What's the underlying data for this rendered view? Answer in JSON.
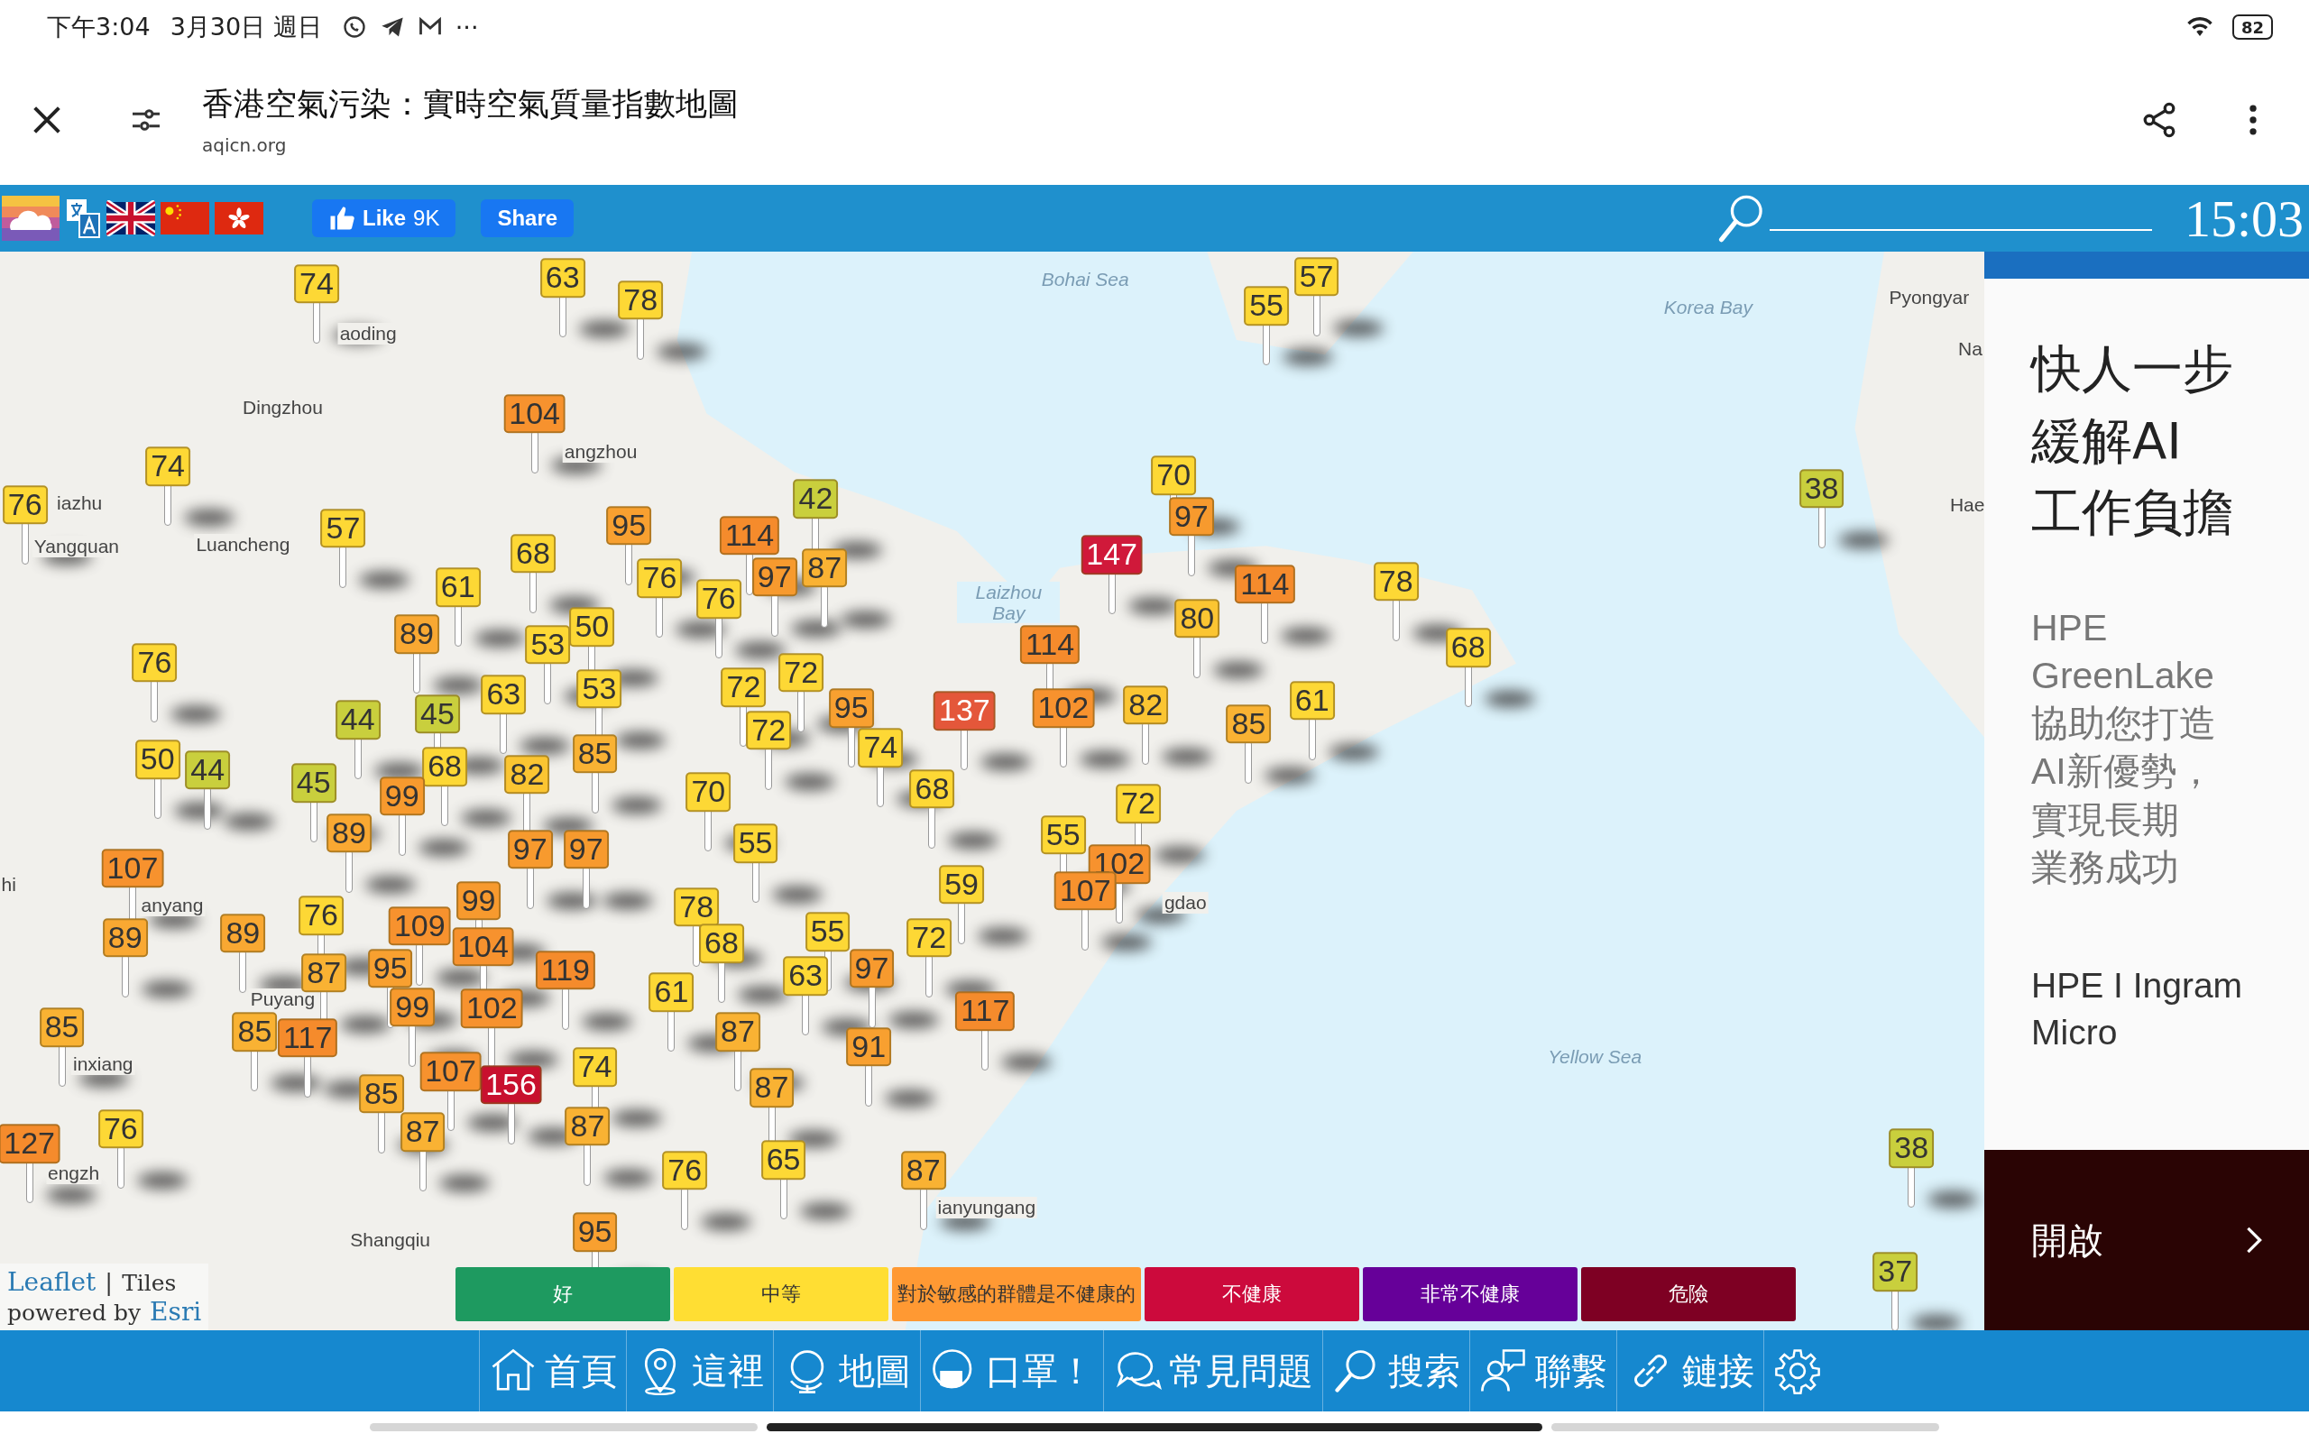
{
  "status_bar": {
    "time": "下午3:04",
    "date": "3月30日 週日",
    "more": "···",
    "battery": "82"
  },
  "browser_header": {
    "title": "香港空氣污染：實時空氣質量指數地圖",
    "url": "aqicn.org"
  },
  "toolbar": {
    "like": {
      "label": "Like",
      "count": "9K"
    },
    "share": "Share",
    "clock": "15:03"
  },
  "map_labels": [
    {
      "text": "aoding"
    },
    {
      "text": "Dingzhou"
    },
    {
      "text": "iazhu"
    },
    {
      "text": "Yangquan"
    },
    {
      "text": "Luancheng"
    },
    {
      "text": "angzhou"
    },
    {
      "text": "Bohai Sea"
    },
    {
      "text": "Korea Bay"
    },
    {
      "text": "Pyongyar"
    },
    {
      "text": "Na"
    },
    {
      "text": "Hae"
    },
    {
      "text": "Laizhou Bay"
    },
    {
      "text": "Yellow Sea"
    },
    {
      "text": "ianyungang"
    },
    {
      "text": "Shangqiu"
    },
    {
      "text": "inxiang"
    },
    {
      "text": "Puyang"
    },
    {
      "text": "hi"
    },
    {
      "text": "anyang"
    },
    {
      "text": "engzh"
    },
    {
      "text": "gdao"
    }
  ],
  "markers": [
    {
      "value": "74",
      "color": "#fdd835"
    },
    {
      "value": "63",
      "color": "#fdd835"
    },
    {
      "value": "78",
      "color": "#fdd835"
    },
    {
      "value": "55",
      "color": "#fdd835"
    },
    {
      "value": "57",
      "color": "#fdd835"
    },
    {
      "value": "104",
      "color": "#f7922e"
    },
    {
      "value": "74",
      "color": "#fdd835"
    },
    {
      "value": "70",
      "color": "#fdd835"
    },
    {
      "value": "76",
      "color": "#fdd835"
    },
    {
      "value": "57",
      "color": "#fdd835"
    },
    {
      "value": "95",
      "color": "#f8a030"
    },
    {
      "value": "114",
      "color": "#f58b2c"
    },
    {
      "value": "42",
      "color": "#c9cf3d"
    },
    {
      "value": "97",
      "color": "#f79a2e"
    },
    {
      "value": "38",
      "color": "#c9cf3d"
    },
    {
      "value": "61",
      "color": "#fdd835"
    },
    {
      "value": "68",
      "color": "#fdd835"
    },
    {
      "value": "76",
      "color": "#fdd835"
    },
    {
      "value": "76",
      "color": "#fdd835"
    },
    {
      "value": "97",
      "color": "#f79a2e"
    },
    {
      "value": "87",
      "color": "#f9b233"
    },
    {
      "value": "147",
      "color": "#d0193a"
    },
    {
      "value": "114",
      "color": "#f58b2c"
    },
    {
      "value": "78",
      "color": "#fdd835"
    },
    {
      "value": "76",
      "color": "#fdd835"
    },
    {
      "value": "89",
      "color": "#f9a832"
    },
    {
      "value": "53",
      "color": "#fdd835"
    },
    {
      "value": "50",
      "color": "#fdd835"
    },
    {
      "value": "114",
      "color": "#f58b2c"
    },
    {
      "value": "80",
      "color": "#fbc532"
    },
    {
      "value": "68",
      "color": "#fdd835"
    },
    {
      "value": "44",
      "color": "#c9cf3d"
    },
    {
      "value": "45",
      "color": "#c9cf3d"
    },
    {
      "value": "63",
      "color": "#fdd835"
    },
    {
      "value": "53",
      "color": "#fdd835"
    },
    {
      "value": "72",
      "color": "#fdd835"
    },
    {
      "value": "72",
      "color": "#fdd835"
    },
    {
      "value": "95",
      "color": "#f8a030"
    },
    {
      "value": "137",
      "color": "#e4573a"
    },
    {
      "value": "102",
      "color": "#f7922e"
    },
    {
      "value": "82",
      "color": "#fbc532"
    },
    {
      "value": "61",
      "color": "#fdd835"
    },
    {
      "value": "50",
      "color": "#fdd835"
    },
    {
      "value": "44",
      "color": "#c9cf3d"
    },
    {
      "value": "68",
      "color": "#fdd835"
    },
    {
      "value": "82",
      "color": "#fbc532"
    },
    {
      "value": "85",
      "color": "#f9b233"
    },
    {
      "value": "72",
      "color": "#fdd835"
    },
    {
      "value": "74",
      "color": "#fdd835"
    },
    {
      "value": "85",
      "color": "#f9b233"
    },
    {
      "value": "45",
      "color": "#c9cf3d"
    },
    {
      "value": "89",
      "color": "#f9a832"
    },
    {
      "value": "99",
      "color": "#f79a2e"
    },
    {
      "value": "70",
      "color": "#fdd835"
    },
    {
      "value": "68",
      "color": "#fdd835"
    },
    {
      "value": "55",
      "color": "#fdd835"
    },
    {
      "value": "72",
      "color": "#fdd835"
    },
    {
      "value": "107",
      "color": "#f7922e"
    },
    {
      "value": "97",
      "color": "#f79a2e"
    },
    {
      "value": "97",
      "color": "#f79a2e"
    },
    {
      "value": "55",
      "color": "#fdd835"
    },
    {
      "value": "59",
      "color": "#fdd835"
    },
    {
      "value": "107",
      "color": "#f7922e"
    },
    {
      "value": "102",
      "color": "#f7922e"
    },
    {
      "value": "89",
      "color": "#f9a832"
    },
    {
      "value": "89",
      "color": "#f9a832"
    },
    {
      "value": "76",
      "color": "#fdd835"
    },
    {
      "value": "109",
      "color": "#f7922e"
    },
    {
      "value": "99",
      "color": "#f79a2e"
    },
    {
      "value": "104",
      "color": "#f7922e"
    },
    {
      "value": "78",
      "color": "#fdd835"
    },
    {
      "value": "68",
      "color": "#fdd835"
    },
    {
      "value": "55",
      "color": "#fdd835"
    },
    {
      "value": "72",
      "color": "#fdd835"
    },
    {
      "value": "87",
      "color": "#f9b233"
    },
    {
      "value": "95",
      "color": "#f8a030"
    },
    {
      "value": "99",
      "color": "#f79a2e"
    },
    {
      "value": "102",
      "color": "#f7922e"
    },
    {
      "value": "119",
      "color": "#f58b2c"
    },
    {
      "value": "61",
      "color": "#fdd835"
    },
    {
      "value": "63",
      "color": "#fdd835"
    },
    {
      "value": "97",
      "color": "#f79a2e"
    },
    {
      "value": "117",
      "color": "#f58b2c"
    },
    {
      "value": "85",
      "color": "#f9b233"
    },
    {
      "value": "85",
      "color": "#f9b233"
    },
    {
      "value": "117",
      "color": "#f58b2c"
    },
    {
      "value": "107",
      "color": "#f7922e"
    },
    {
      "value": "74",
      "color": "#fdd835"
    },
    {
      "value": "87",
      "color": "#f9b233"
    },
    {
      "value": "91",
      "color": "#f8a030"
    },
    {
      "value": "76",
      "color": "#fdd835"
    },
    {
      "value": "85",
      "color": "#f9b233"
    },
    {
      "value": "87",
      "color": "#f9b233"
    },
    {
      "value": "156",
      "color": "#c8102e"
    },
    {
      "value": "87",
      "color": "#f9b233"
    },
    {
      "value": "87",
      "color": "#f9b233"
    },
    {
      "value": "127",
      "color": "#f58b2c"
    },
    {
      "value": "76",
      "color": "#fdd835"
    },
    {
      "value": "65",
      "color": "#fdd835"
    },
    {
      "value": "87",
      "color": "#f9b233"
    },
    {
      "value": "38",
      "color": "#c9cf3d"
    },
    {
      "value": "95",
      "color": "#f8a030"
    },
    {
      "value": "37",
      "color": "#c9cf3d"
    }
  ],
  "attribution": {
    "leaflet": "Leaflet",
    "separator": "|",
    "tiles": "Tiles",
    "powered": "powered by",
    "esri": "Esri"
  },
  "legend": [
    {
      "label": "好",
      "color": "#1e9a60"
    },
    {
      "label": "中等",
      "color": "#ffde33"
    },
    {
      "label": "對於敏感的群體是不健康的",
      "color": "#ff9933"
    },
    {
      "label": "不健康",
      "color": "#cc0a3c"
    },
    {
      "label": "非常不健康",
      "color": "#660099"
    },
    {
      "label": "危險",
      "color": "#7e0023"
    }
  ],
  "ad": {
    "headline": [
      "快人一步",
      "緩解AI",
      "工作負擔"
    ],
    "body": [
      "HPE",
      "GreenLake",
      "協助您打造",
      "AI新優勢，",
      "實現長期",
      "業務成功"
    ],
    "advertiser": [
      "HPE I Ingram",
      "Micro"
    ],
    "cta": "開啟"
  },
  "nav": [
    {
      "label": "首頁",
      "kind": "home"
    },
    {
      "label": "這裡",
      "kind": "pin"
    },
    {
      "label": "地圖",
      "kind": "globe"
    },
    {
      "label": "口罩！",
      "kind": "mask"
    },
    {
      "label": "常見問題",
      "kind": "faq"
    },
    {
      "label": "搜索",
      "kind": "search"
    },
    {
      "label": "聯繫",
      "kind": "contact"
    },
    {
      "label": "鏈接",
      "kind": "link"
    },
    {
      "kind": "settings"
    }
  ]
}
